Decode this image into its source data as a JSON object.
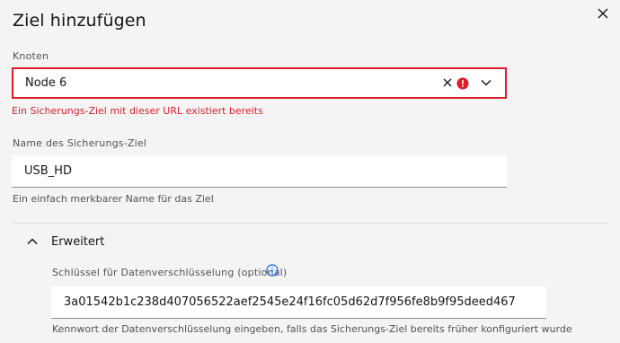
{
  "dialog": {
    "title": "Ziel hinzufügen",
    "close_icon": "close-icon"
  },
  "node_field": {
    "label": "Knoten",
    "value": "Node 6",
    "error": "Ein Sicherungs-Ziel mit dieser URL existiert bereits",
    "icons": [
      "clear-icon",
      "error-icon",
      "chevron-down-icon"
    ]
  },
  "name_field": {
    "label": "Name des Sicherungs-Ziel",
    "value": "USB_HD",
    "helper": "Ein einfach merkbarer Name für das Ziel"
  },
  "advanced": {
    "title": "Erweitert",
    "expanded": true,
    "key_field": {
      "label": "Schlüssel für Datenverschlüsselung (optional)",
      "value": "3a01542b1c238d407056522aef2545e24f16fc05d62d7f956fe8b9f95deed467",
      "helper": "Kennwort der Datenverschlüsselung eingeben, falls das Sicherungs-Ziel bereits früher konfiguriert wurde"
    }
  },
  "colors": {
    "background": "#f4f4f4",
    "error": "#da1e28",
    "info": "#0f62fe",
    "text": "#161616",
    "muted": "#525252"
  }
}
